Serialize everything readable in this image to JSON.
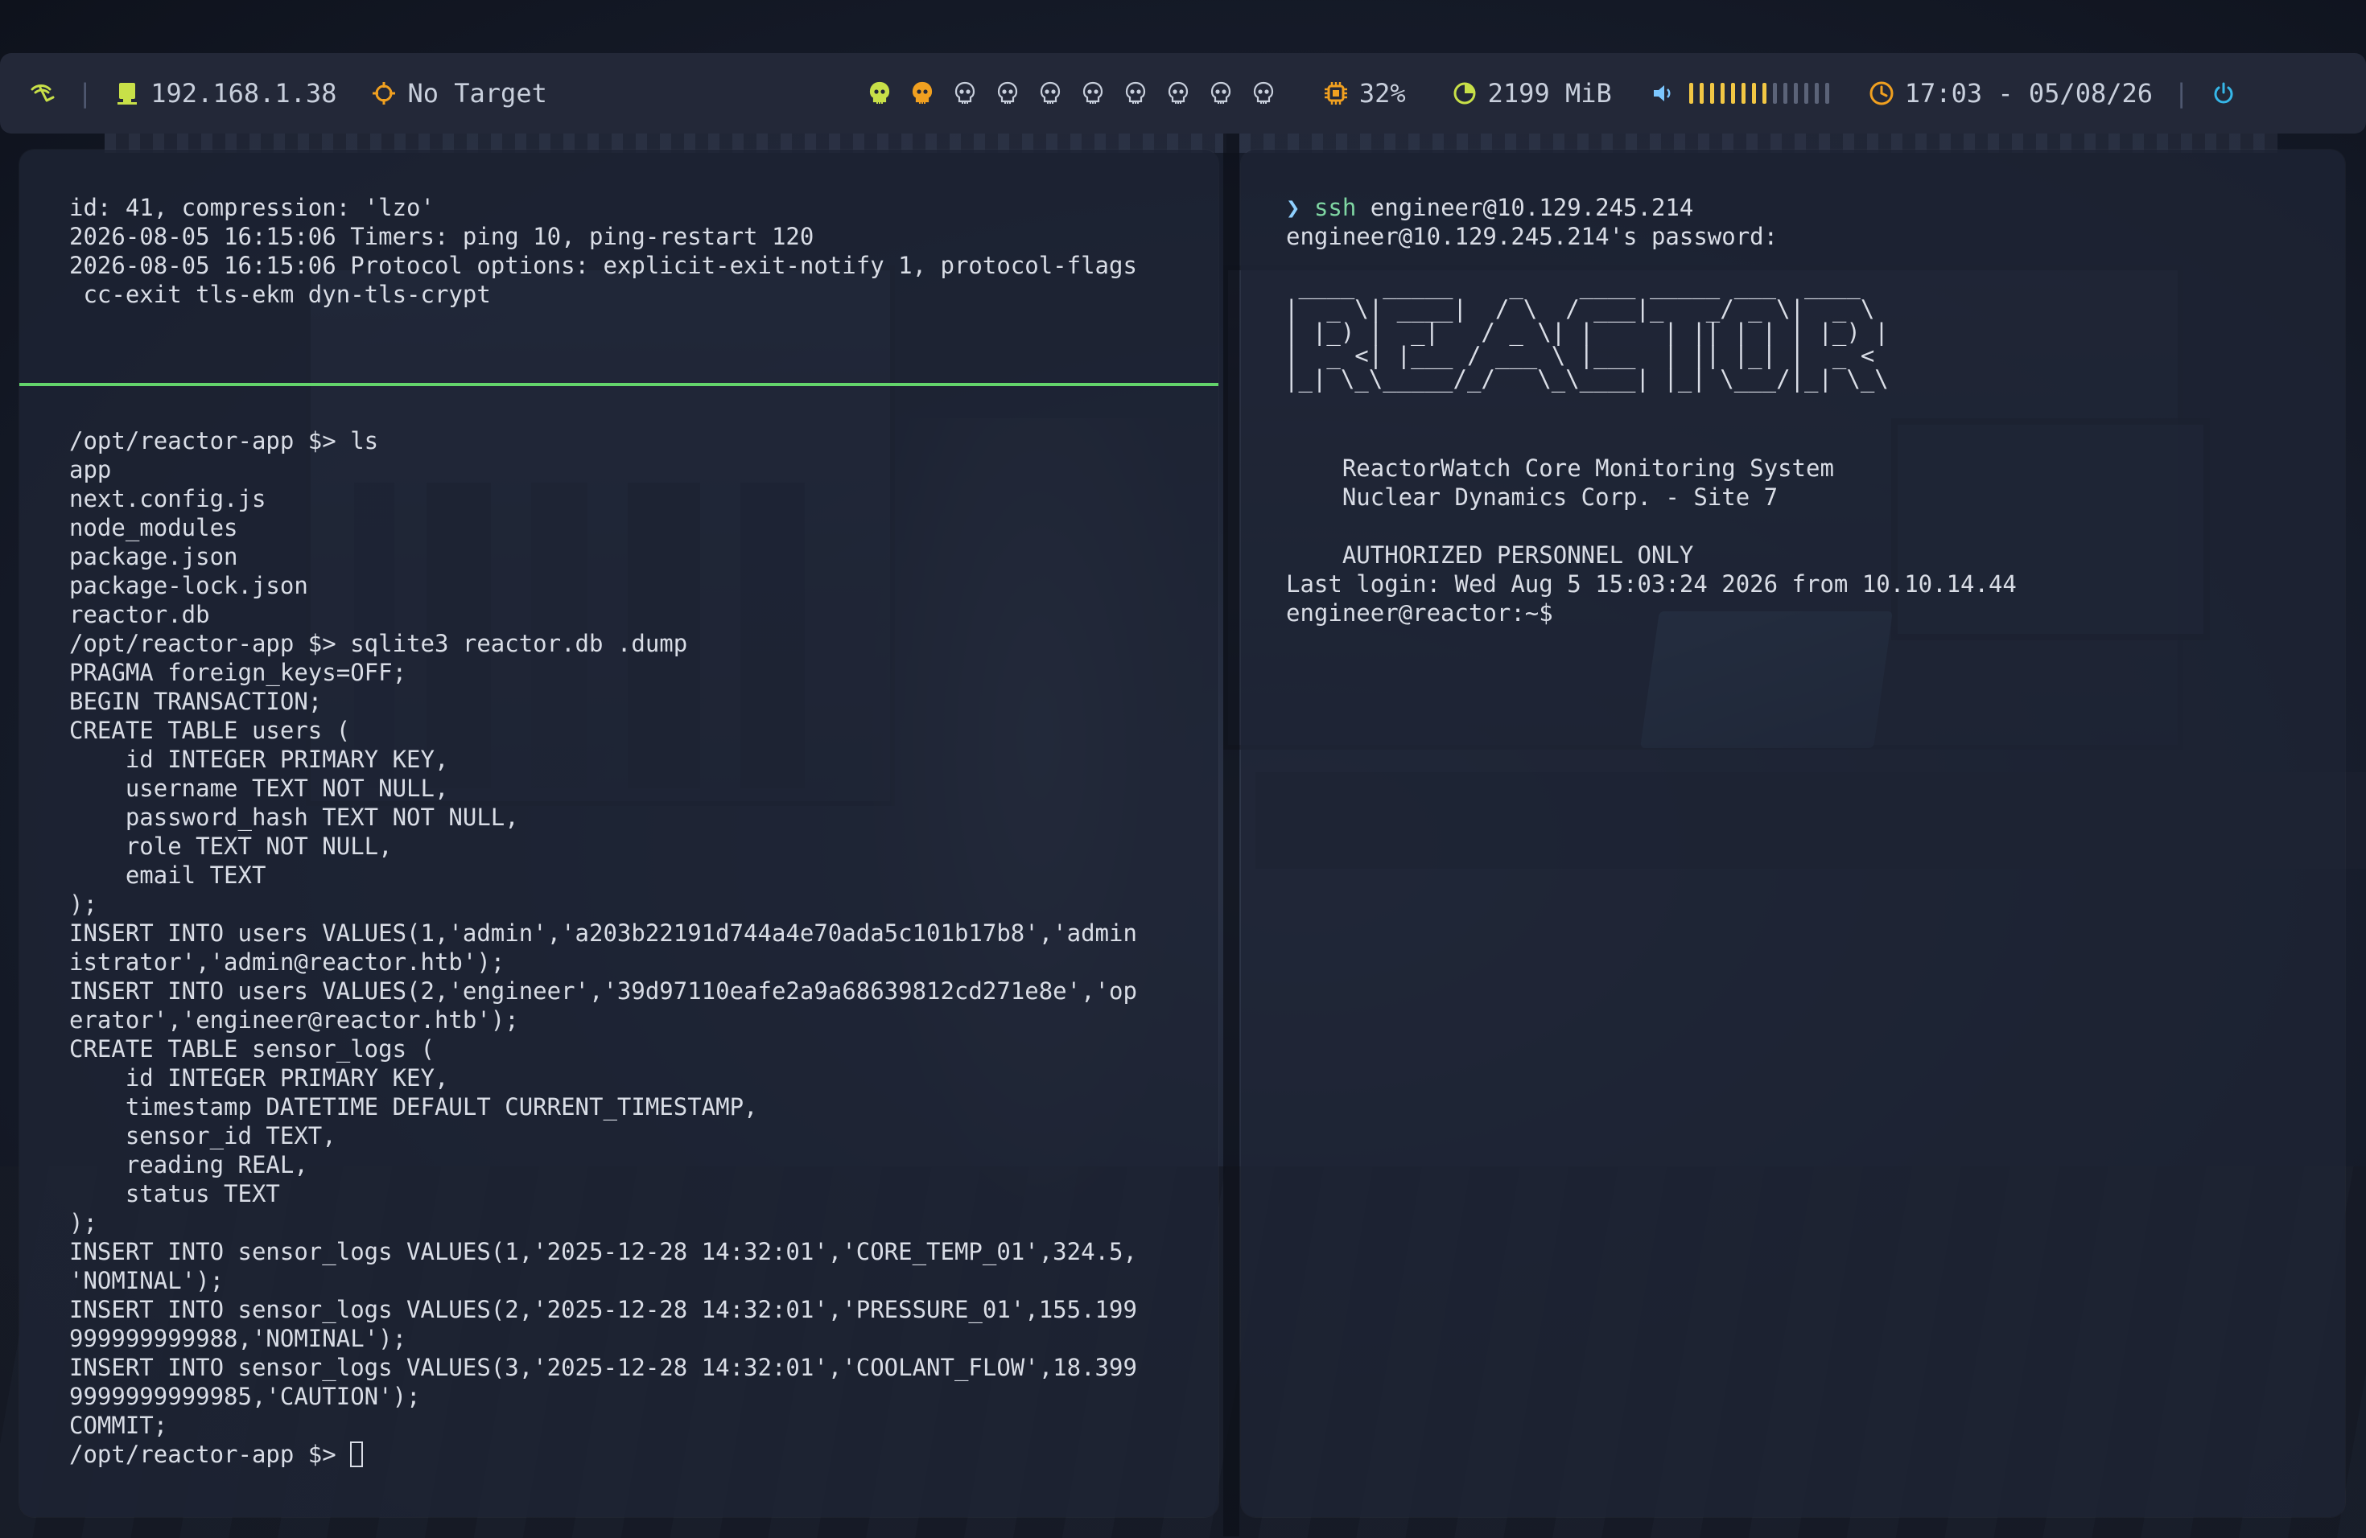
{
  "statusbar": {
    "ip_address": "192.168.1.38",
    "target": "No Target",
    "workspaces": [
      "ws1",
      "ws2",
      "ws3",
      "ws4",
      "ws5",
      "ws6",
      "ws7",
      "ws8",
      "ws9",
      "ws10"
    ],
    "active_workspace": 1,
    "occupied_workspace": 2,
    "cpu": "32%",
    "memory": "2199 MiB",
    "volume_level": 0.6,
    "clock": "17:03 - 05/08/26",
    "colors": {
      "bar_bg": "#232838",
      "ip_icon": "#c8e048",
      "target_icon": "#f0a020",
      "ws_active": "#c8e048",
      "ws_occupied": "#f0a020",
      "cpu_icon": "#f0a020",
      "mem_icon": "#c8e048",
      "volume_icon": "#7cc7ff",
      "volume_bar_on": "#f2c744",
      "volume_bar_off": "#5b6378",
      "clock_icon": "#f0a020",
      "power_icon": "#36b7e8"
    }
  },
  "left_terminal": {
    "top_log": [
      "id: 41, compression: 'lzo'",
      "2026-08-05 16:15:06 Timers: ping 10, ping-restart 120",
      "2026-08-05 16:15:06 Protocol options: explicit-exit-notify 1, protocol-flags",
      " cc-exit tls-ekm dyn-tls-crypt"
    ],
    "bottom_output": [
      "/opt/reactor-app $> ls",
      "app",
      "next.config.js",
      "node_modules",
      "package.json",
      "package-lock.json",
      "reactor.db",
      "/opt/reactor-app $> sqlite3 reactor.db .dump",
      "PRAGMA foreign_keys=OFF;",
      "BEGIN TRANSACTION;",
      "CREATE TABLE users (",
      "    id INTEGER PRIMARY KEY,",
      "    username TEXT NOT NULL,",
      "    password_hash TEXT NOT NULL,",
      "    role TEXT NOT NULL,",
      "    email TEXT",
      ");",
      "INSERT INTO users VALUES(1,'admin','a203b22191d744a4e70ada5c101b17b8','admin",
      "istrator','admin@reactor.htb');",
      "INSERT INTO users VALUES(2,'engineer','39d97110eafe2a9a68639812cd271e8e','op",
      "erator','engineer@reactor.htb');",
      "CREATE TABLE sensor_logs (",
      "    id INTEGER PRIMARY KEY,",
      "    timestamp DATETIME DEFAULT CURRENT_TIMESTAMP,",
      "    sensor_id TEXT,",
      "    reading REAL,",
      "    status TEXT",
      ");",
      "INSERT INTO sensor_logs VALUES(1,'2025-12-28 14:32:01','CORE_TEMP_01',324.5,",
      "'NOMINAL');",
      "INSERT INTO sensor_logs VALUES(2,'2025-12-28 14:32:01','PRESSURE_01',155.199",
      "999999999988,'NOMINAL');",
      "INSERT INTO sensor_logs VALUES(3,'2025-12-28 14:32:01','COOLANT_FLOW',18.399",
      "9999999999985,'CAUTION');",
      "COMMIT;"
    ],
    "prompt": "/opt/reactor-app $> "
  },
  "right_terminal": {
    "prompt_symbol": "❯",
    "ssh_command": "ssh",
    "ssh_args": " engineer@10.129.245.214",
    "password_prompt": "engineer@10.129.245.214's password:",
    "ascii_banner": [
      " ____  _____    _    ____ _____ ___  ____  ",
      "|  _ \\| ____|  / \\  / ___|_   _/ _ \\|  _ \\ ",
      "| |_) |  _|   / _ \\| |     | || | | | |_) |",
      "|  _ <| |___ / ___ \\ |___  | || |_| |  _ < ",
      "|_| \\_\\_____/_/   \\_\\____| |_| \\___/|_| \\_\\"
    ],
    "motd": [
      "",
      "    ReactorWatch Core Monitoring System",
      "    Nuclear Dynamics Corp. - Site 7",
      "",
      "    AUTHORIZED PERSONNEL ONLY",
      "Last login: Wed Aug 5 15:03:24 2026 from 10.10.14.44",
      "engineer@reactor:~$ "
    ]
  }
}
